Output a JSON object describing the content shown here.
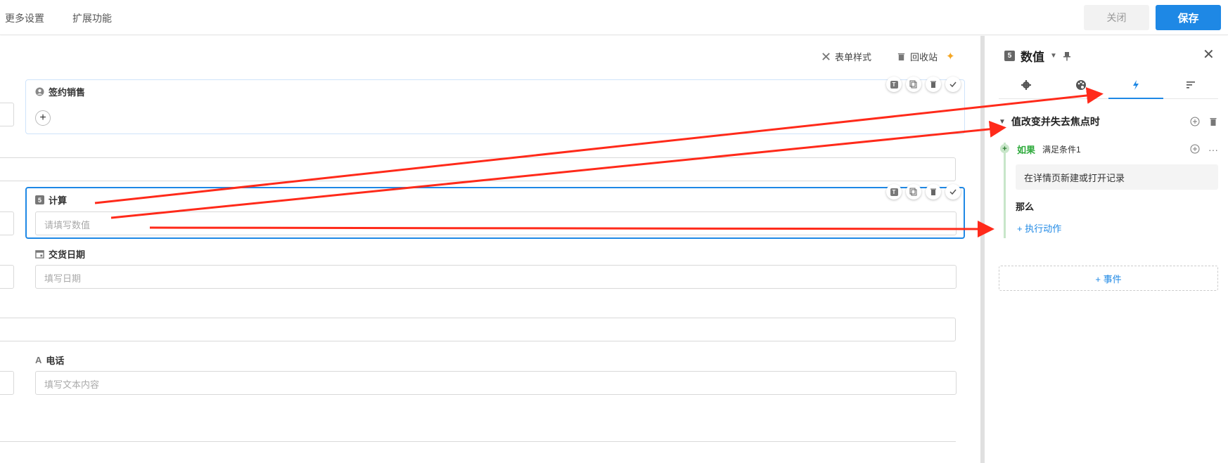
{
  "topbar": {
    "nav_more": "更多设置",
    "nav_ext": "扩展功能",
    "close_label": "关闭",
    "save_label": "保存"
  },
  "canvas": {
    "form_style": "表单样式",
    "recycle": "回收站",
    "fields": {
      "sales": {
        "label": "签约销售",
        "add": "+"
      },
      "calc": {
        "label": "计算",
        "placeholder": "请填写数值",
        "icon_text": "5"
      },
      "delivery": {
        "label": "交货日期",
        "placeholder": "填写日期"
      },
      "phone": {
        "label": "电话",
        "placeholder": "填写文本内容",
        "icon_text": "A"
      }
    },
    "tool_text": "T"
  },
  "panel": {
    "title": "数值",
    "title_icon_text": "5",
    "tabs": [
      "settings",
      "style",
      "events",
      "sort"
    ],
    "event": {
      "name": "值改变并失去焦点时",
      "if_keyword": "如果",
      "if_condition": "满足条件1",
      "condition_text": "在详情页新建或打开记录",
      "then_label": "那么",
      "action_link": "+ 执行动作"
    },
    "add_event": "+ 事件"
  },
  "colors": {
    "accent": "#1e88e5",
    "annotation": "#ff2a1a",
    "if_green": "#2eaa3c"
  }
}
